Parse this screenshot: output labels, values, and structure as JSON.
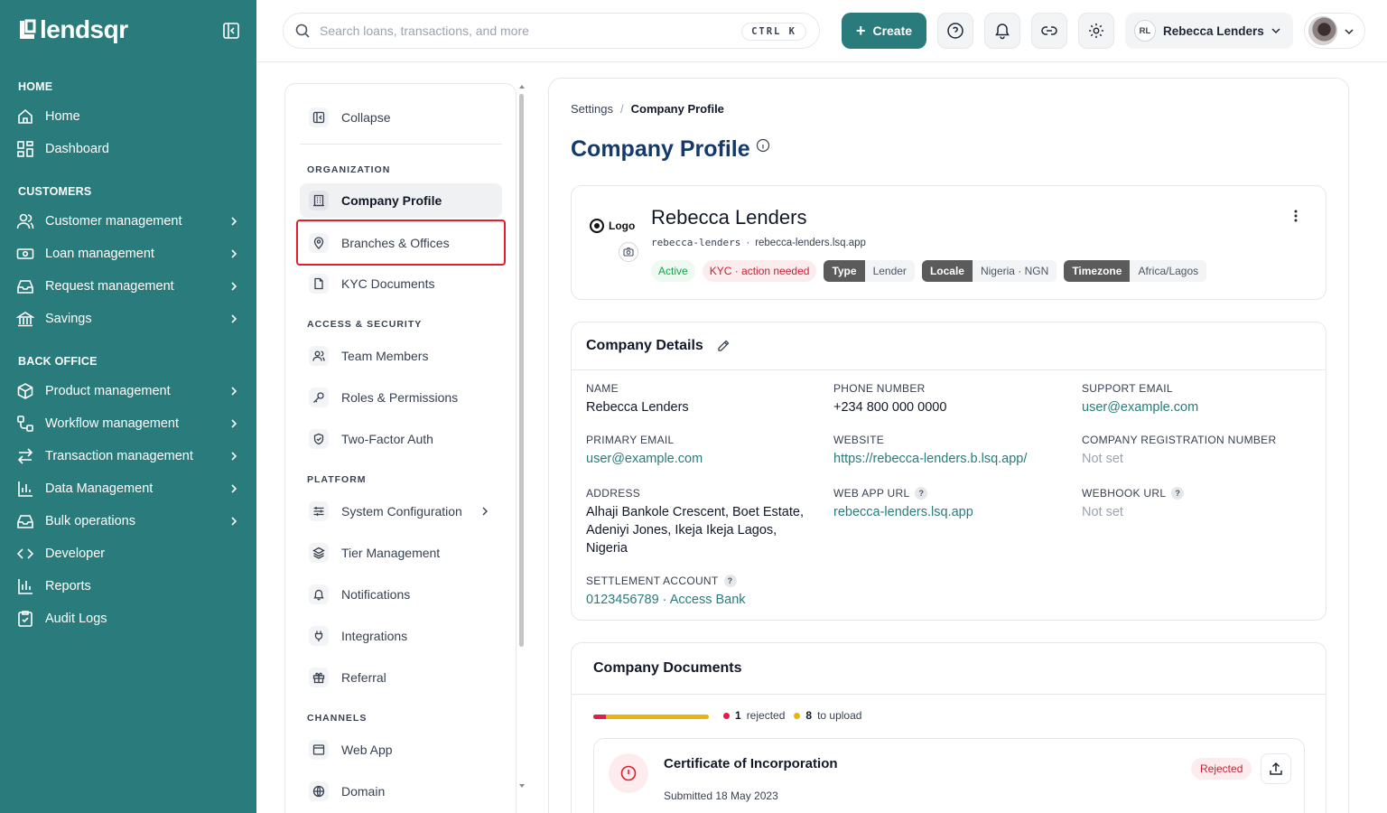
{
  "brand": {
    "name": "lendsqr"
  },
  "sidebar": {
    "sections": {
      "home": "HOME",
      "customers": "CUSTOMERS",
      "back_office": "BACK OFFICE"
    },
    "items": {
      "home": "Home",
      "dashboard": "Dashboard",
      "customer_management": "Customer management",
      "loan_management": "Loan management",
      "request_management": "Request management",
      "savings": "Savings",
      "product_management": "Product management",
      "workflow_management": "Workflow management",
      "transaction_management": "Transaction management",
      "data_management": "Data Management",
      "bulk_operations": "Bulk operations",
      "developer": "Developer",
      "reports": "Reports",
      "audit_logs": "Audit Logs"
    }
  },
  "topbar": {
    "search_placeholder": "Search loans, transactions, and more",
    "shortcut": "CTRL K",
    "create_label": "Create",
    "org_initials": "RL",
    "org_name": "Rebecca Lenders"
  },
  "settings_nav": {
    "collapse": "Collapse",
    "sections": {
      "organization": "ORGANIZATION",
      "access_security": "ACCESS & SECURITY",
      "platform": "PLATFORM",
      "channels": "CHANNELS"
    },
    "items": {
      "company_profile": "Company Profile",
      "branches_offices": "Branches & Offices",
      "kyc_documents": "KYC Documents",
      "team_members": "Team Members",
      "roles_permissions": "Roles & Permissions",
      "two_factor_auth": "Two-Factor Auth",
      "system_configuration": "System Configuration",
      "tier_management": "Tier Management",
      "notifications": "Notifications",
      "integrations": "Integrations",
      "referral": "Referral",
      "web_app": "Web App",
      "domain": "Domain"
    }
  },
  "breadcrumb": {
    "parent": "Settings",
    "separator": "/",
    "current": "Company Profile"
  },
  "page": {
    "title": "Company Profile"
  },
  "profile": {
    "logo_label": "Logo",
    "name": "Rebecca Lenders",
    "slug": "rebecca-lenders",
    "dot": "·",
    "domain": "rebecca-lenders.lsq.app",
    "status": "Active",
    "kyc": "KYC · action needed",
    "type_label": "Type",
    "type_value": "Lender",
    "locale_label": "Locale",
    "locale_value": "Nigeria · NGN",
    "timezone_label": "Timezone",
    "timezone_value": "Africa/Lagos"
  },
  "company_details": {
    "title": "Company Details",
    "help": "?",
    "name_label": "NAME",
    "name": "Rebecca Lenders",
    "phone_label": "PHONE NUMBER",
    "phone": "+234 800 000 0000",
    "support_email_label": "SUPPORT EMAIL",
    "support_email": "user@example.com",
    "primary_email_label": "PRIMARY EMAIL",
    "primary_email": "user@example.com",
    "website_label": "WEBSITE",
    "website": "https://rebecca-lenders.b.lsq.app/",
    "reg_number_label": "COMPANY REGISTRATION NUMBER",
    "reg_number": "Not set",
    "address_label": "ADDRESS",
    "address_line1": "Alhaji Bankole Crescent, Boet Estate,",
    "address_line2": "Adeniyi Jones, Ikeja Ikeja Lagos,",
    "address_line3": "Nigeria",
    "web_app_url_label": "WEB APP URL",
    "web_app_url": "rebecca-lenders.lsq.app",
    "webhook_url_label": "WEBHOOK URL",
    "webhook_url": "Not set",
    "settlement_label": "SETTLEMENT ACCOUNT",
    "settlement": "0123456789 · Access Bank"
  },
  "company_documents": {
    "title": "Company Documents",
    "rejected_count": "1",
    "rejected_label": "rejected",
    "upload_count": "8",
    "upload_label": "to upload",
    "rejected_fraction": 0.11,
    "items": [
      {
        "title": "Certificate of Incorporation",
        "submitted": "Submitted 18 May 2023",
        "status": "Rejected"
      }
    ]
  },
  "colors": {
    "brand": "#2a7b7b",
    "title": "#14396b",
    "danger": "#e11d2e",
    "warning": "#e8b40f",
    "success": "#16a34a"
  }
}
